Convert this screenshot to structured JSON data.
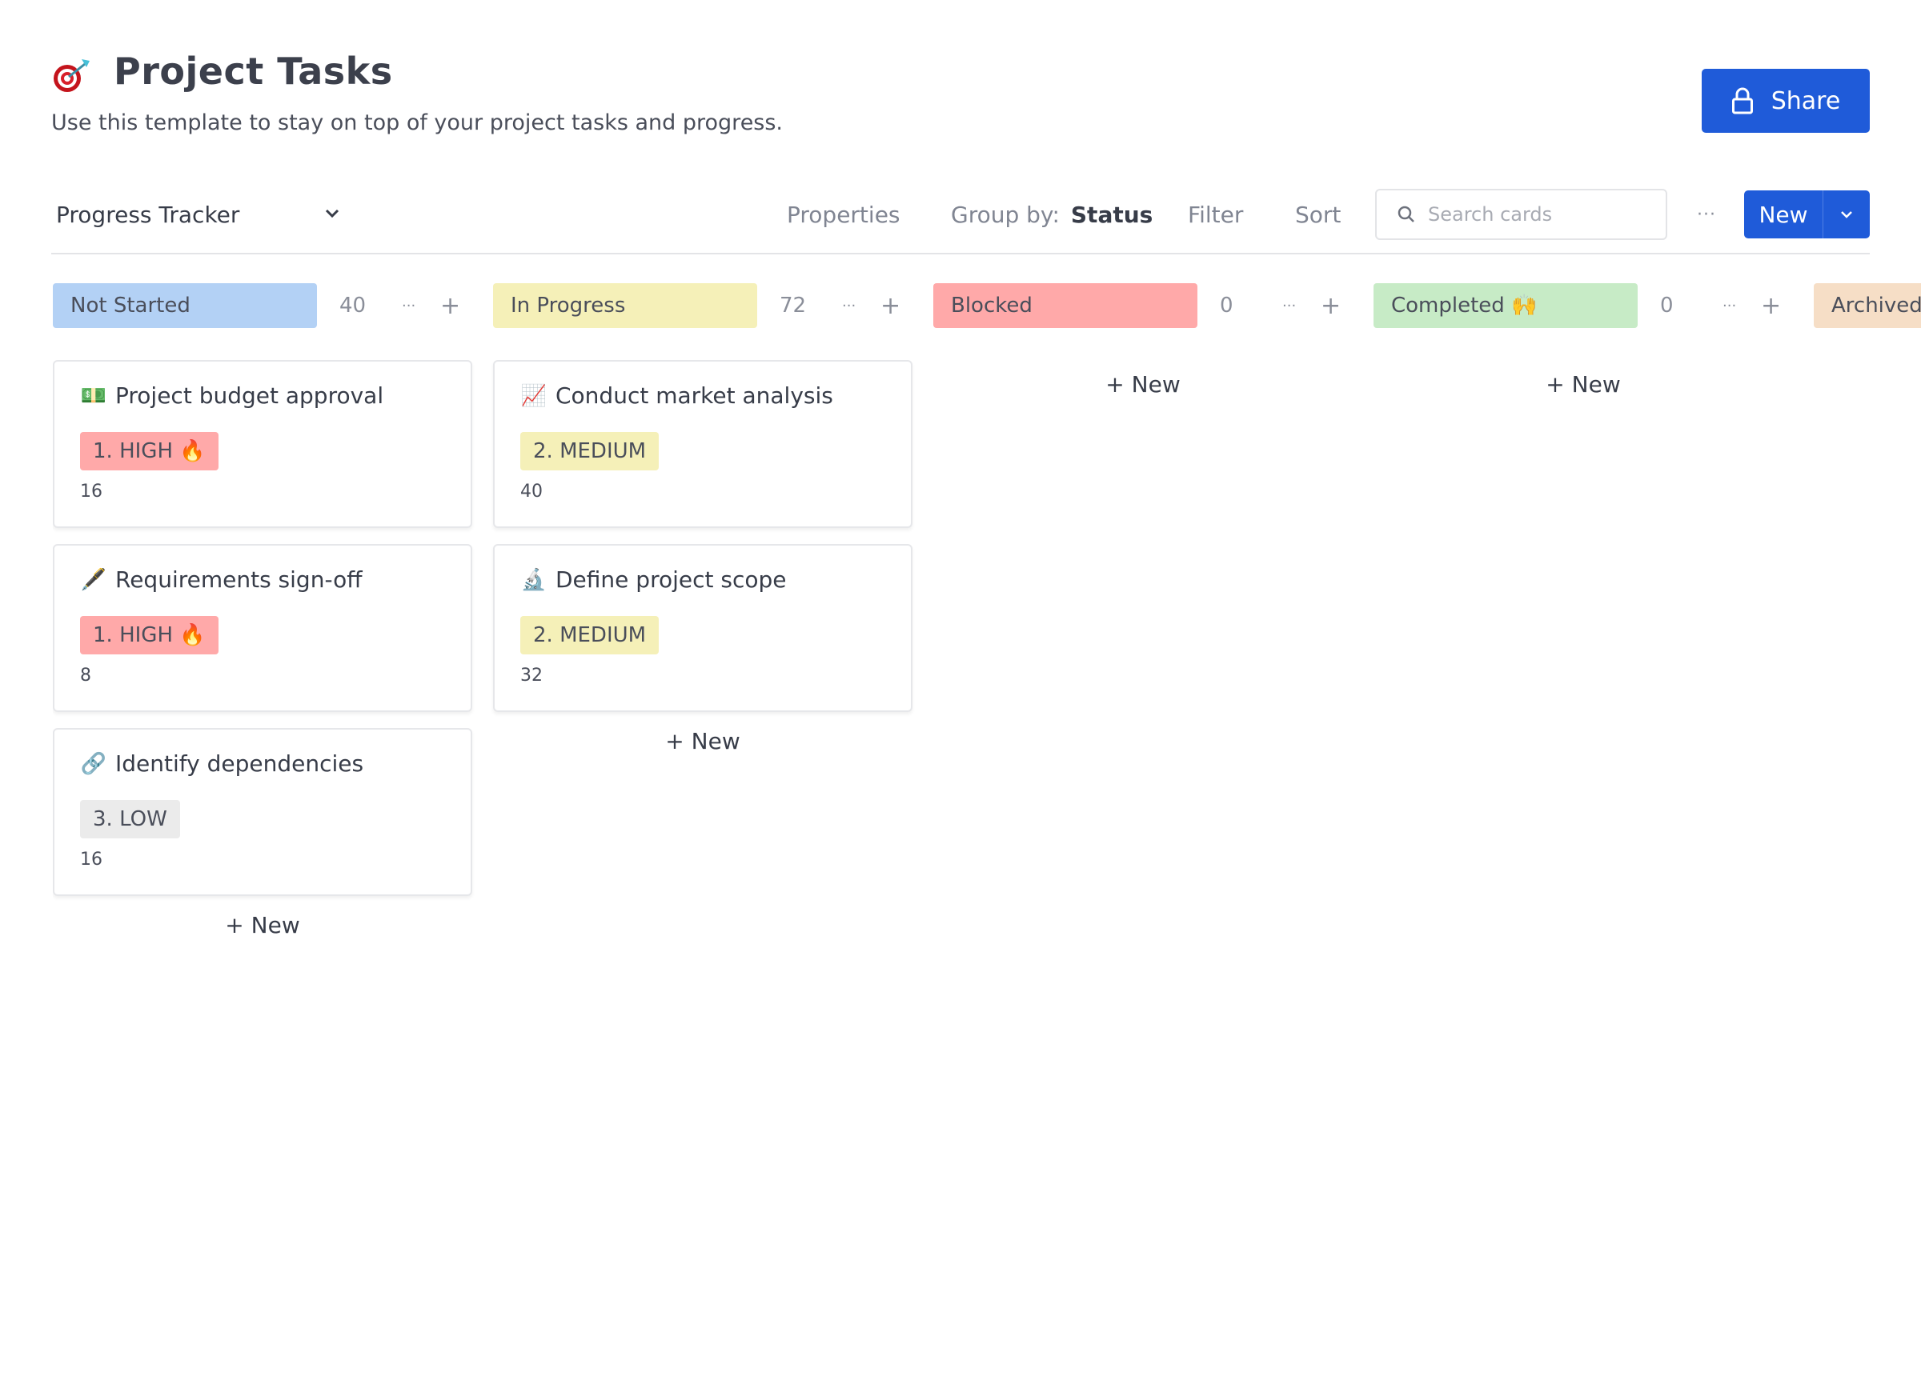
{
  "header": {
    "title_icon": "direct-hit-target-emoji",
    "title": "Project Tasks",
    "subtitle": "Use this template to stay on top of your project tasks and progress.",
    "share_label": "Share",
    "share_icon": "lock-icon"
  },
  "toolbar": {
    "view_name": "Progress Tracker",
    "properties_label": "Properties",
    "group_by_label": "Group by:",
    "group_by_value": "Status",
    "filter_label": "Filter",
    "sort_label": "Sort",
    "search_placeholder": "Search cards",
    "search_value": "",
    "more_label": "···",
    "new_label": "New"
  },
  "colors": {
    "primary": "#1f5bd9",
    "not_started": "#b3d1f5",
    "in_progress": "#f5f0b8",
    "blocked": "#ffa9a9",
    "completed": "#c7ebc6",
    "archived": "#f6dec6",
    "high": "#ffa9a9",
    "medium": "#f5f0b8",
    "low": "#ebebeb"
  },
  "columns": [
    {
      "label": "Not Started",
      "count": "40",
      "color": "#b3d1f5",
      "add_label": "+ New",
      "cards": [
        {
          "icon": "💵",
          "title": "Project budget approval",
          "priority": "1. HIGH 🔥",
          "priority_color": "#ffa9a9",
          "value": "16"
        },
        {
          "icon": "🖋️",
          "title": "Requirements sign-off",
          "priority": "1. HIGH 🔥",
          "priority_color": "#ffa9a9",
          "value": "8"
        },
        {
          "icon": "🔗",
          "title": "Identify dependencies",
          "priority": "3. LOW",
          "priority_color": "#ebebeb",
          "value": "16"
        }
      ]
    },
    {
      "label": "In Progress",
      "count": "72",
      "color": "#f5f0b8",
      "add_label": "+ New",
      "cards": [
        {
          "icon": "📈",
          "title": "Conduct market analysis",
          "priority": "2. MEDIUM",
          "priority_color": "#f5f0b8",
          "value": "40"
        },
        {
          "icon": "🔬",
          "title": "Define project scope",
          "priority": "2. MEDIUM",
          "priority_color": "#f5f0b8",
          "value": "32"
        }
      ]
    },
    {
      "label": "Blocked",
      "count": "0",
      "color": "#ffa9a9",
      "add_label": "+ New",
      "cards": []
    },
    {
      "label": "Completed 🙌",
      "count": "0",
      "color": "#c7ebc6",
      "add_label": "+ New",
      "cards": []
    },
    {
      "label": "Archived",
      "count": "",
      "color": "#f6dec6",
      "add_label": "",
      "cards": []
    }
  ]
}
